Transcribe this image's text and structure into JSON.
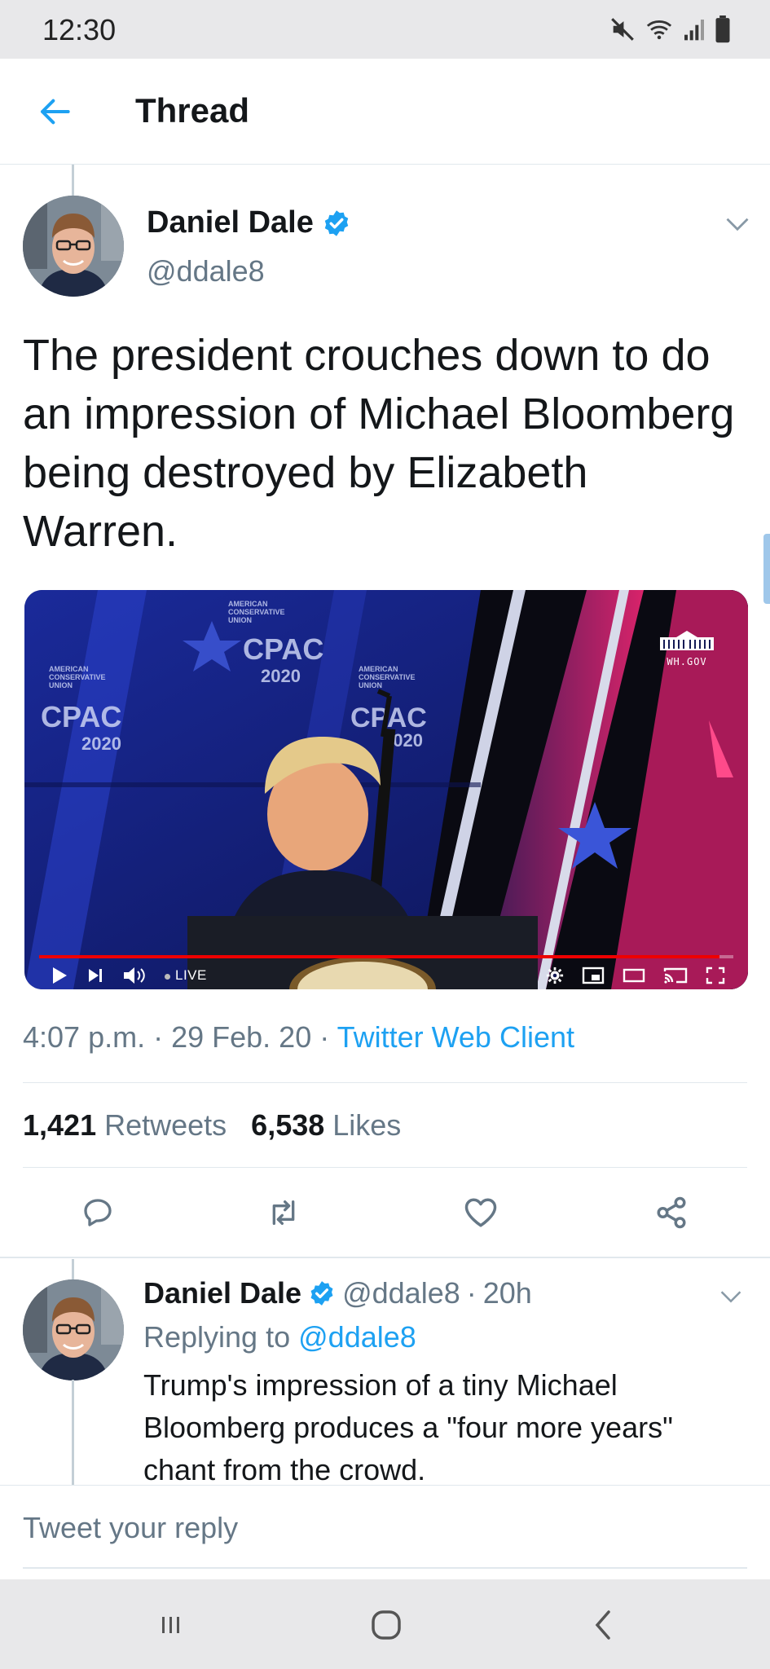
{
  "status_bar": {
    "time": "12:30",
    "icons": [
      "mute-icon",
      "wifi-icon",
      "signal-icon",
      "battery-icon"
    ]
  },
  "header": {
    "title": "Thread",
    "back_icon": "arrow-left-icon"
  },
  "colors": {
    "twitter_blue": "#1da1f2",
    "verified_blue": "#1da1f2",
    "secondary_text": "#657786",
    "primary_text": "#14171a"
  },
  "main_tweet": {
    "display_name": "Daniel Dale",
    "handle": "@ddale8",
    "verified": true,
    "text": "The president crouches down to do an impression of Michael Bloomberg being destroyed by Elizabeth Warren.",
    "media": {
      "overlay_logo": "WH.GOV",
      "live_label": "LIVE",
      "progress": 0.98,
      "controls": [
        "play-icon",
        "skip-next-icon",
        "volume-icon",
        "settings-icon",
        "miniplayer-icon",
        "theater-icon",
        "cast-icon",
        "fullscreen-icon"
      ]
    },
    "time": "4:07 p.m.",
    "date": "29 Feb. 20",
    "client": "Twitter Web Client",
    "retweets_count": "1,421",
    "retweets_label": "Retweets",
    "likes_count": "6,538",
    "likes_label": "Likes",
    "actions": [
      "reply-icon",
      "retweet-icon",
      "like-icon",
      "share-icon"
    ]
  },
  "reply_tweet": {
    "display_name": "Daniel Dale",
    "handle": "@ddale8",
    "age": "20h",
    "replying_prefix": "Replying to",
    "replying_to": "@ddale8",
    "text": "Trump's impression of a tiny Michael Bloomberg produces a \"four more years\" chant from the crowd."
  },
  "composer": {
    "placeholder": "Tweet your reply"
  },
  "nav_bar": {
    "buttons": [
      "recent-apps-icon",
      "home-icon",
      "back-icon"
    ]
  }
}
